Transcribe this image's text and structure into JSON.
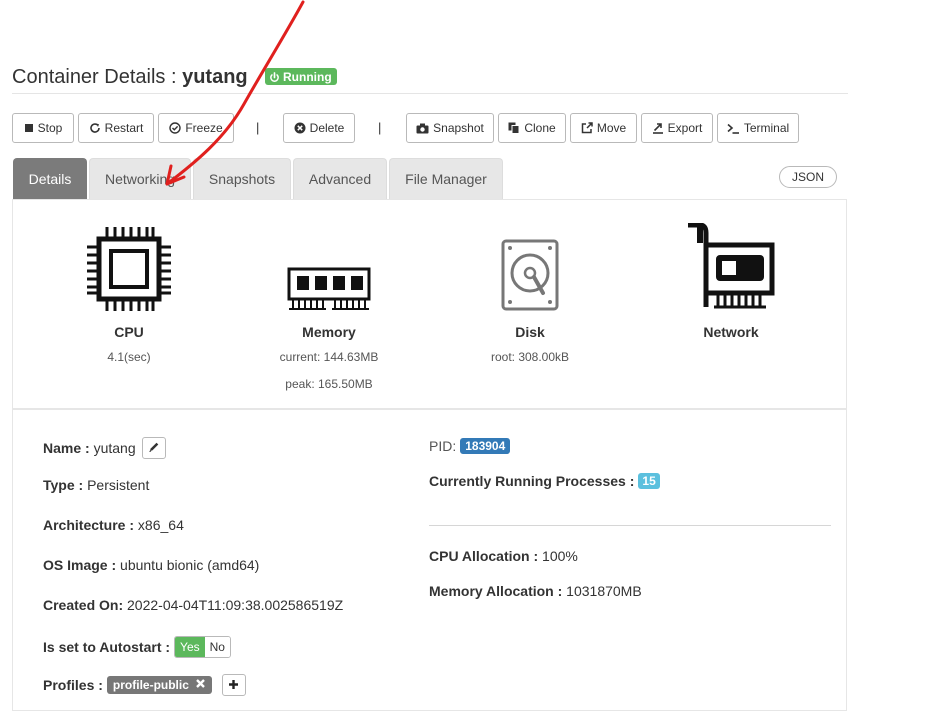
{
  "header": {
    "title_prefix": "Container Details : ",
    "container_name": "yutang",
    "status": "Running"
  },
  "toolbar": {
    "stop": "Stop",
    "restart": "Restart",
    "freeze": "Freeze",
    "delete": "Delete",
    "snapshot": "Snapshot",
    "clone": "Clone",
    "move": "Move",
    "export": "Export",
    "terminal": "Terminal",
    "separator": "|"
  },
  "tabs": [
    {
      "label": "Details",
      "active": true
    },
    {
      "label": "Networking"
    },
    {
      "label": "Snapshots"
    },
    {
      "label": "Advanced"
    },
    {
      "label": "File Manager"
    }
  ],
  "json_button": "JSON",
  "resources": {
    "cpu": {
      "label": "CPU",
      "value": "4.1(sec)"
    },
    "memory": {
      "label": "Memory",
      "current": "current: 144.63MB",
      "peak": "peak: 165.50MB"
    },
    "disk": {
      "label": "Disk",
      "root": "root: 308.00kB"
    },
    "network": {
      "label": "Network"
    }
  },
  "details": {
    "name_key": "Name :",
    "name_val": "yutang",
    "type_key": "Type :",
    "type_val": "Persistent",
    "arch_key": "Architecture :",
    "arch_val": "x86_64",
    "os_key": "OS Image :",
    "os_val": "ubuntu bionic (amd64)",
    "created_key": "Created On:",
    "created_val": "2022-04-04T11:09:38.002586519Z",
    "autostart_key": "Is set to Autostart :",
    "autostart_yes": "Yes",
    "autostart_no": "No",
    "profiles_key": "Profiles :",
    "profile_tag": "profile-public"
  },
  "runtime": {
    "pid_key": "PID:",
    "pid_val": "183904",
    "procs_key": "Currently Running Processes :",
    "procs_val": "15",
    "cpu_alloc_key": "CPU Allocation :",
    "cpu_alloc_val": "100%",
    "mem_alloc_key": "Memory Allocation :",
    "mem_alloc_val": "1031870MB"
  },
  "colors": {
    "running_badge": "#5cb85c",
    "active_tab": "#7b7b7b",
    "pid_label": "#337ab7",
    "procs_label": "#5bc0de",
    "annotation_arrow": "#e0201e"
  }
}
